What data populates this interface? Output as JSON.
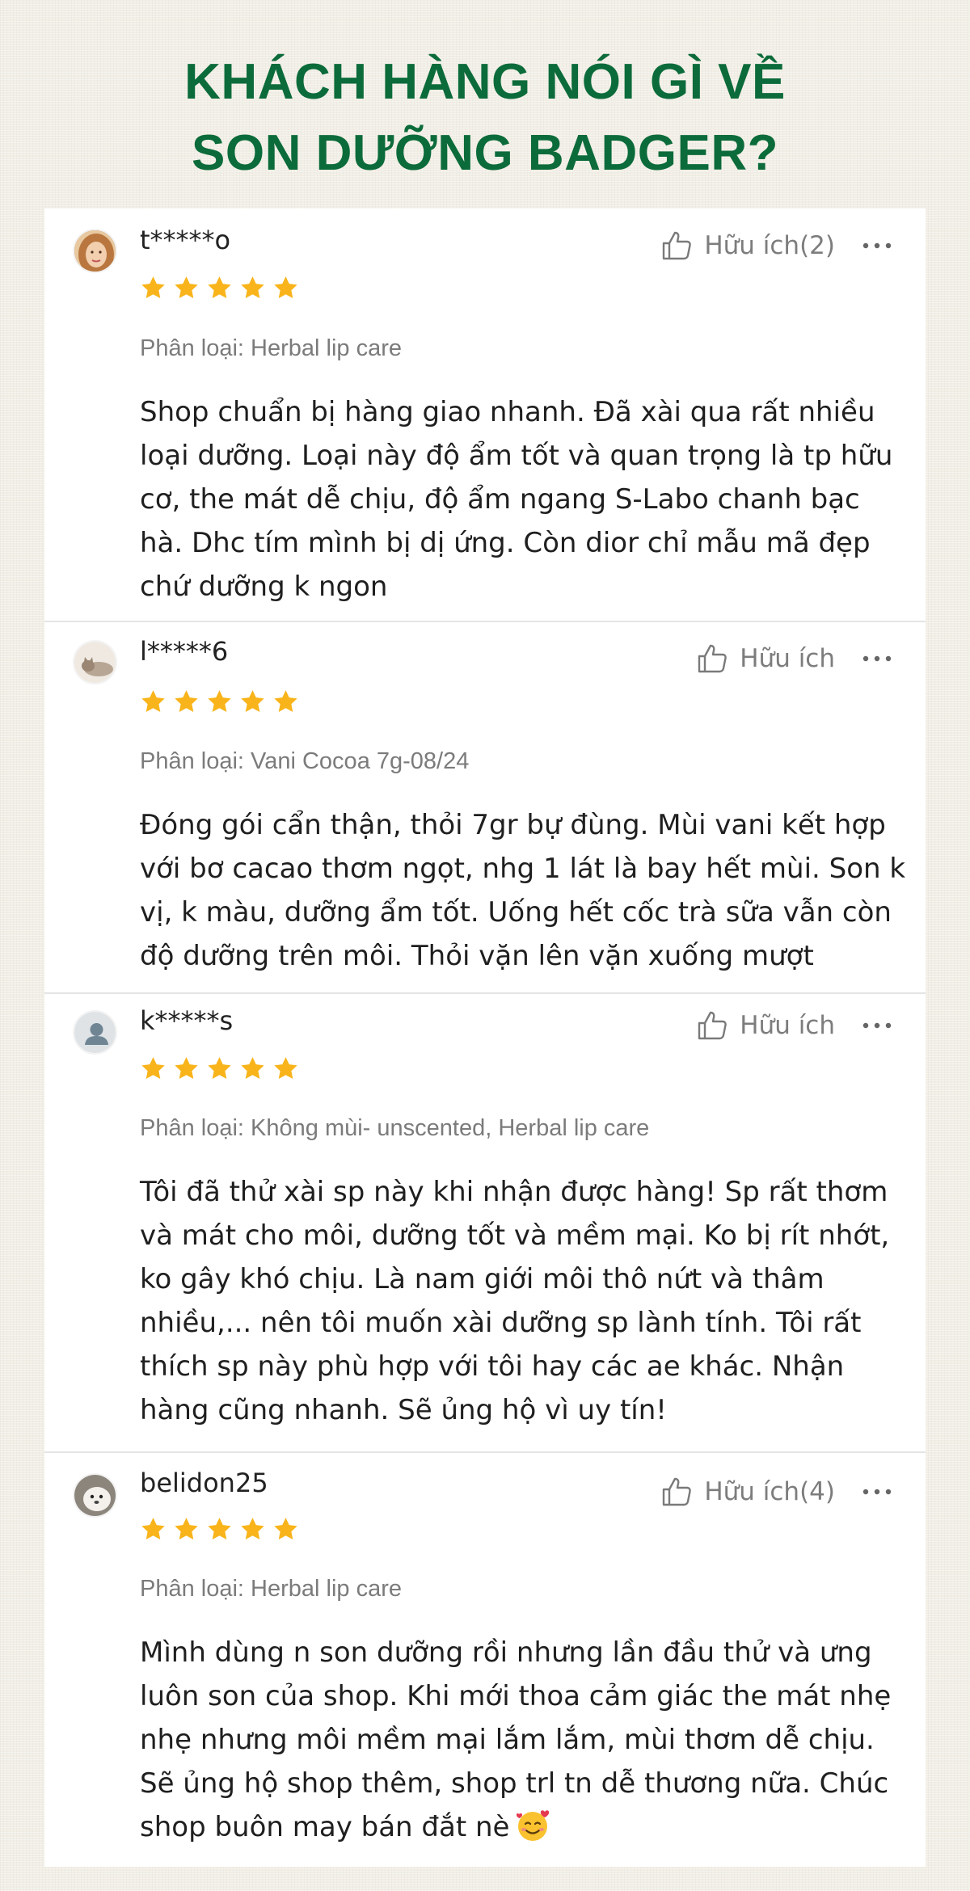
{
  "heading": {
    "line1": "KHÁCH HÀNG NÓI GÌ VỀ",
    "line2": "SON DƯỠNG BADGER?"
  },
  "colors": {
    "heading": "#0c6b3a",
    "star": "#f8b41a"
  },
  "reviews": [
    {
      "username": "t*****o",
      "avatar": "woman-photo",
      "helpful_label": "Hữu ích(2)",
      "rating": 5,
      "variant": "Phân loại: Herbal lip care",
      "comment": "Shop chuẩn bị hàng giao nhanh. Đã xài qua rất nhiều loại dưỡng. Loại này độ ẩm tốt và quan trọng là tp hữu cơ, the mát dễ chịu, độ ẩm ngang S-Labo chanh bạc hà. Dhc tím mình bị dị ứng. Còn dior chỉ mẫu mã đẹp chứ dưỡng k ngon"
    },
    {
      "username": "l*****6",
      "avatar": "cat-photo",
      "helpful_label": "Hữu ích",
      "rating": 5,
      "variant": "Phân loại: Vani Cocoa 7g-08/24",
      "comment": "Đóng gói cẩn thận, thỏi 7gr bự đùng. Mùi vani kết hợp với bơ cacao thơm ngọt, nhg 1 lát là bay hết mùi. Son k vị, k màu, dưỡng ẩm tốt. Uống hết cốc trà sữa vẫn còn độ dưỡng trên môi. Thỏi vặn lên vặn xuống mượt"
    },
    {
      "username": "k*****s",
      "avatar": "default-user",
      "helpful_label": "Hữu ích",
      "rating": 5,
      "variant": "Phân loại: Không mùi- unscented, Herbal lip care",
      "comment": "Tôi đã thử xài sp này khi nhận được hàng! Sp rất thơm và mát cho môi, dưỡng tốt và mềm mại. Ko bị rít nhớt, ko gây khó chịu. Là nam giới môi thô nứt và thâm nhiều,... nên tôi muốn xài dưỡng sp lành tính. Tôi rất thích sp này phù hợp với tôi hay các ae khác. Nhận hàng cũng nhanh. Sẽ ủng hộ vì uy tín!"
    },
    {
      "username": "belidon25",
      "avatar": "pet-photo",
      "helpful_label": "Hữu ích(4)",
      "rating": 5,
      "variant": "Phân loại: Herbal lip care",
      "comment": "Mình dùng n son dưỡng rồi nhưng lần đầu thử và ưng luôn son của shop. Khi mới thoa cảm giác the mát nhẹ nhẹ nhưng môi mềm mại lắm lắm, mùi thơm dễ chịu. Sẽ ủng hộ shop thêm, shop trl tn dễ thương nữa. Chúc shop buôn may bán đắt nè",
      "emoji": "smiling-face-with-hearts-icon"
    }
  ]
}
